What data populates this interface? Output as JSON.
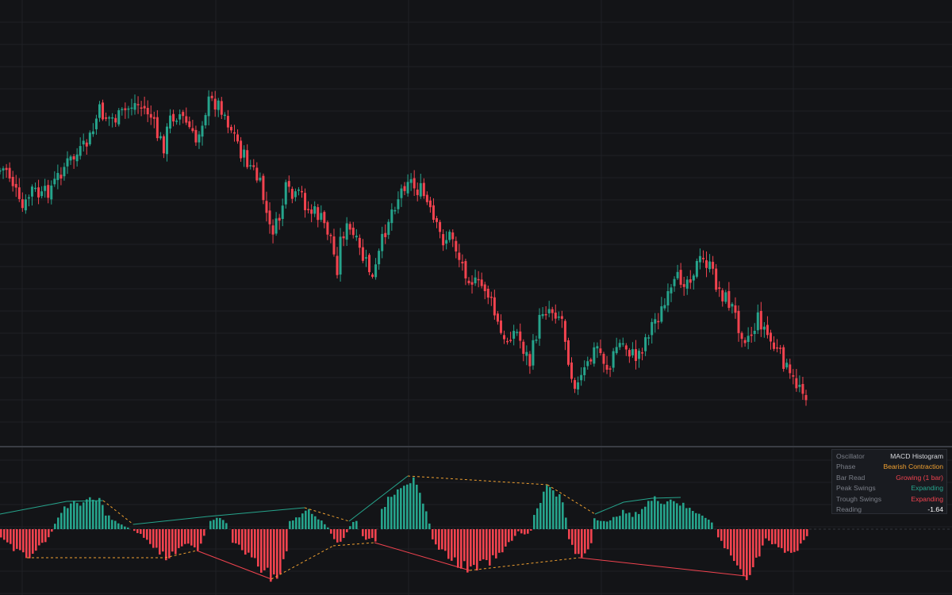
{
  "colors": {
    "background": "#131417",
    "grid": "#1f2126",
    "separator": "#3a3d44",
    "bull": "#26a48c",
    "bear": "#f2434f",
    "swing_connector": "#f0a030"
  },
  "info_panel": {
    "rows": [
      {
        "label": "Oscillator",
        "value": "MACD Histogram",
        "color": "#d8dade"
      },
      {
        "label": "Phase",
        "value": "Bearish Contraction",
        "color": "#f0a030"
      },
      {
        "label": "Bar Read",
        "value": "Growing (1 bar)",
        "color": "#f2434f"
      },
      {
        "label": "Peak Swings",
        "value": "Expanding",
        "color": "#26a48c"
      },
      {
        "label": "Trough Swings",
        "value": "Expanding",
        "color": "#f2434f"
      },
      {
        "label": "Reading",
        "value": "-1.64",
        "color": "#ffffff"
      }
    ]
  },
  "chart_data": [
    {
      "type": "candlestick",
      "title": "",
      "grid": true,
      "n_bars": 252,
      "price_path": [
        [
          0,
          215
        ],
        [
          8,
          212
        ],
        [
          18,
          235
        ],
        [
          25,
          262
        ],
        [
          30,
          265
        ],
        [
          40,
          238
        ],
        [
          52,
          250
        ],
        [
          60,
          240
        ],
        [
          68,
          232
        ],
        [
          80,
          210
        ],
        [
          92,
          200
        ],
        [
          104,
          190
        ],
        [
          116,
          170
        ],
        [
          124,
          140
        ],
        [
          135,
          148
        ],
        [
          148,
          150
        ],
        [
          158,
          140
        ],
        [
          168,
          130
        ],
        [
          175,
          133
        ],
        [
          188,
          142
        ],
        [
          198,
          170
        ],
        [
          206,
          185
        ],
        [
          215,
          148
        ],
        [
          225,
          142
        ],
        [
          238,
          160
        ],
        [
          246,
          182
        ],
        [
          255,
          150
        ],
        [
          262,
          130
        ],
        [
          270,
          128
        ],
        [
          280,
          135
        ],
        [
          288,
          155
        ],
        [
          298,
          175
        ],
        [
          305,
          195
        ],
        [
          318,
          212
        ],
        [
          330,
          240
        ],
        [
          340,
          290
        ],
        [
          350,
          285
        ],
        [
          360,
          240
        ],
        [
          370,
          252
        ],
        [
          380,
          245
        ],
        [
          388,
          265
        ],
        [
          400,
          270
        ],
        [
          408,
          282
        ],
        [
          418,
          300
        ],
        [
          424,
          345
        ],
        [
          430,
          295
        ],
        [
          438,
          288
        ],
        [
          446,
          300
        ],
        [
          455,
          322
        ],
        [
          465,
          338
        ],
        [
          470,
          355
        ],
        [
          478,
          320
        ],
        [
          488,
          280
        ],
        [
          496,
          258
        ],
        [
          506,
          240
        ],
        [
          514,
          222
        ],
        [
          522,
          236
        ],
        [
          532,
          242
        ],
        [
          540,
          262
        ],
        [
          548,
          285
        ],
        [
          558,
          302
        ],
        [
          570,
          296
        ],
        [
          580,
          330
        ],
        [
          590,
          345
        ],
        [
          600,
          360
        ],
        [
          612,
          362
        ],
        [
          620,
          385
        ],
        [
          628,
          412
        ],
        [
          636,
          435
        ],
        [
          644,
          418
        ],
        [
          652,
          420
        ],
        [
          660,
          440
        ],
        [
          668,
          458
        ],
        [
          676,
          420
        ],
        [
          684,
          390
        ],
        [
          692,
          388
        ],
        [
          700,
          392
        ],
        [
          708,
          400
        ],
        [
          714,
          435
        ],
        [
          720,
          470
        ],
        [
          728,
          488
        ],
        [
          736,
          470
        ],
        [
          744,
          455
        ],
        [
          752,
          435
        ],
        [
          760,
          452
        ],
        [
          768,
          468
        ],
        [
          776,
          438
        ],
        [
          784,
          432
        ],
        [
          792,
          440
        ],
        [
          800,
          452
        ],
        [
          808,
          440
        ],
        [
          816,
          420
        ],
        [
          824,
          405
        ],
        [
          832,
          395
        ],
        [
          840,
          382
        ],
        [
          848,
          365
        ],
        [
          856,
          350
        ],
        [
          866,
          352
        ],
        [
          874,
          340
        ],
        [
          882,
          330
        ],
        [
          890,
          330
        ],
        [
          898,
          345
        ],
        [
          906,
          365
        ],
        [
          914,
          375
        ],
        [
          922,
          385
        ],
        [
          930,
          408
        ],
        [
          940,
          425
        ],
        [
          948,
          420
        ],
        [
          956,
          400
        ],
        [
          964,
          415
        ],
        [
          972,
          432
        ],
        [
          980,
          445
        ],
        [
          988,
          455
        ],
        [
          996,
          478
        ],
        [
          1004,
          485
        ],
        [
          1010,
          480
        ],
        [
          1016,
          500
        ]
      ],
      "histogram": [
        [
          0,
          -12
        ],
        [
          10,
          -20
        ],
        [
          20,
          -28
        ],
        [
          30,
          -33
        ],
        [
          36,
          -35
        ],
        [
          46,
          -25
        ],
        [
          56,
          -15
        ],
        [
          64,
          -3
        ],
        [
          66,
          0
        ],
        [
          68,
          8
        ],
        [
          80,
          28
        ],
        [
          96,
          33
        ],
        [
          110,
          35
        ],
        [
          125,
          37
        ],
        [
          130,
          22
        ],
        [
          140,
          12
        ],
        [
          150,
          6
        ],
        [
          160,
          2
        ],
        [
          164,
          0
        ],
        [
          168,
          -2
        ],
        [
          178,
          -8
        ],
        [
          190,
          -20
        ],
        [
          200,
          -30
        ],
        [
          208,
          -36
        ],
        [
          218,
          -32
        ],
        [
          230,
          -22
        ],
        [
          240,
          -18
        ],
        [
          248,
          -26
        ],
        [
          256,
          -8
        ],
        [
          260,
          0
        ],
        [
          262,
          8
        ],
        [
          272,
          14
        ],
        [
          282,
          10
        ],
        [
          288,
          0
        ],
        [
          290,
          -15
        ],
        [
          304,
          -25
        ],
        [
          318,
          -40
        ],
        [
          334,
          -55
        ],
        [
          342,
          -62
        ],
        [
          352,
          -55
        ],
        [
          360,
          -30
        ],
        [
          362,
          0
        ],
        [
          364,
          10
        ],
        [
          374,
          14
        ],
        [
          384,
          26
        ],
        [
          394,
          18
        ],
        [
          404,
          12
        ],
        [
          414,
          0
        ],
        [
          418,
          -10
        ],
        [
          426,
          -20
        ],
        [
          432,
          -12
        ],
        [
          438,
          0
        ],
        [
          442,
          8
        ],
        [
          448,
          10
        ],
        [
          452,
          0
        ],
        [
          454,
          -8
        ],
        [
          460,
          -14
        ],
        [
          466,
          -10
        ],
        [
          472,
          -18
        ],
        [
          476,
          0
        ],
        [
          478,
          18
        ],
        [
          488,
          40
        ],
        [
          500,
          55
        ],
        [
          510,
          62
        ],
        [
          518,
          62
        ],
        [
          526,
          45
        ],
        [
          536,
          20
        ],
        [
          542,
          0
        ],
        [
          544,
          -15
        ],
        [
          556,
          -28
        ],
        [
          568,
          -38
        ],
        [
          580,
          -45
        ],
        [
          592,
          -52
        ],
        [
          604,
          -46
        ],
        [
          618,
          -40
        ],
        [
          630,
          -32
        ],
        [
          640,
          -18
        ],
        [
          648,
          -8
        ],
        [
          654,
          0
        ],
        [
          656,
          -5
        ],
        [
          662,
          -8
        ],
        [
          668,
          -2
        ],
        [
          670,
          0
        ],
        [
          672,
          18
        ],
        [
          680,
          38
        ],
        [
          688,
          52
        ],
        [
          694,
          55
        ],
        [
          700,
          48
        ],
        [
          710,
          28
        ],
        [
          714,
          0
        ],
        [
          716,
          -12
        ],
        [
          722,
          -25
        ],
        [
          730,
          -35
        ],
        [
          738,
          -30
        ],
        [
          744,
          -20
        ],
        [
          746,
          0
        ],
        [
          748,
          14
        ],
        [
          756,
          12
        ],
        [
          766,
          8
        ],
        [
          776,
          18
        ],
        [
          786,
          22
        ],
        [
          796,
          16
        ],
        [
          806,
          24
        ],
        [
          816,
          34
        ],
        [
          826,
          38
        ],
        [
          838,
          36
        ],
        [
          848,
          38
        ],
        [
          856,
          32
        ],
        [
          866,
          26
        ],
        [
          876,
          22
        ],
        [
          886,
          18
        ],
        [
          896,
          8
        ],
        [
          900,
          0
        ],
        [
          904,
          -10
        ],
        [
          912,
          -22
        ],
        [
          922,
          -38
        ],
        [
          932,
          -52
        ],
        [
          940,
          -56
        ],
        [
          948,
          -50
        ],
        [
          958,
          -25
        ],
        [
          964,
          -12
        ],
        [
          974,
          -20
        ],
        [
          986,
          -28
        ],
        [
          998,
          -30
        ],
        [
          1004,
          -25
        ],
        [
          1010,
          -18
        ],
        [
          1016,
          -10
        ]
      ],
      "histogram_envelope": {
        "peaks_upper": [
          [
            0,
            648
          ],
          [
            84,
            632
          ],
          [
            130,
            631
          ],
          [
            168,
            661
          ],
          [
            262,
            651
          ],
          [
            384,
            640
          ],
          [
            440,
            657
          ],
          [
            514,
            600
          ],
          [
            690,
            611
          ],
          [
            750,
            648
          ],
          [
            786,
            633
          ],
          [
            822,
            628
          ],
          [
            858,
            627
          ]
        ],
        "troughs_lower": [
          [
            34,
            703
          ],
          [
            208,
            703
          ],
          [
            248,
            694
          ],
          [
            342,
            730
          ],
          [
            420,
            688
          ],
          [
            472,
            684
          ],
          [
            592,
            719
          ],
          [
            730,
            703
          ],
          [
            940,
            726
          ]
        ],
        "connectors_dashed": [
          [
            130,
            631
          ],
          [
            168,
            661
          ]
        ],
        "notes": "swing connectors between oscillator extremes"
      }
    }
  ]
}
